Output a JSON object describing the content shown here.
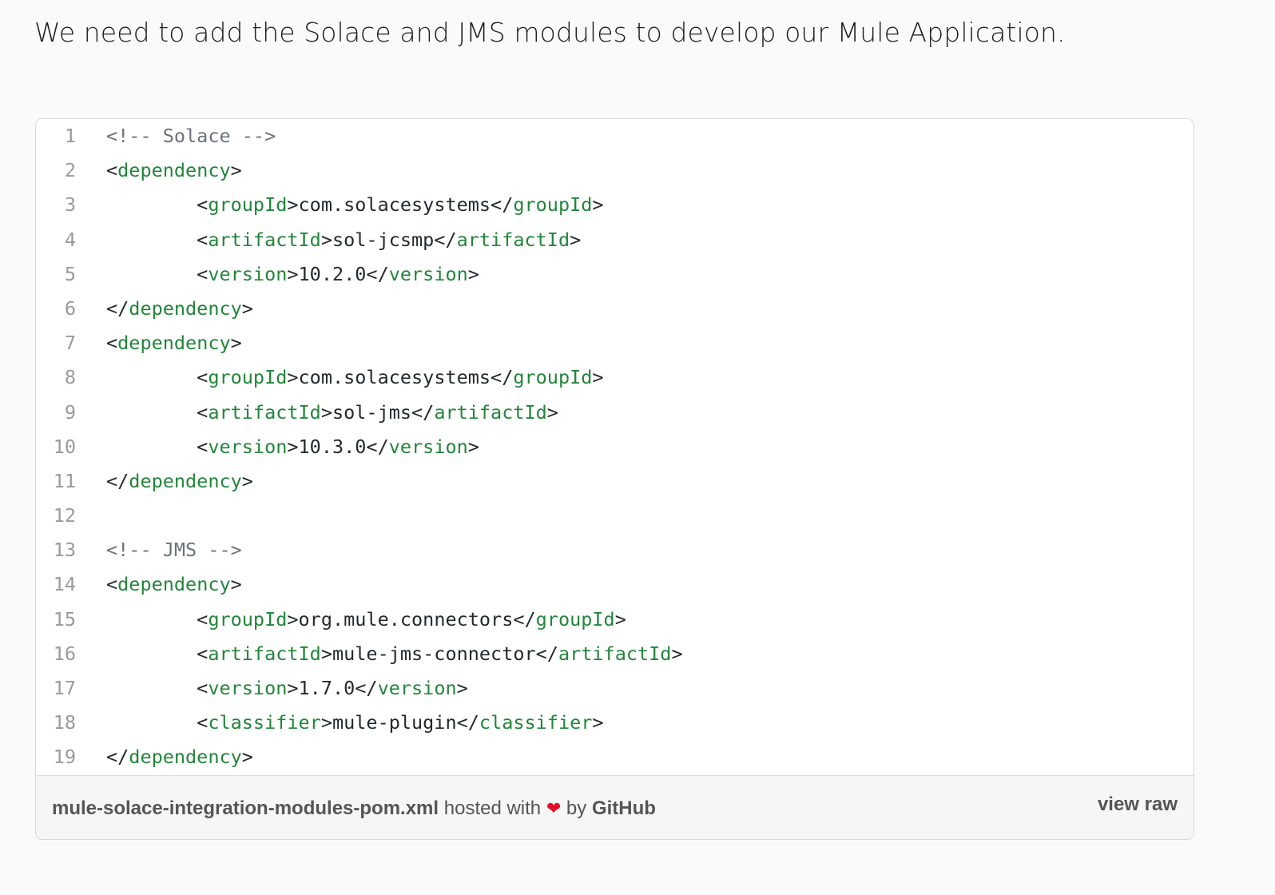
{
  "intro_text": "We need to add the Solace and JMS modules to develop our Mule Application.",
  "code_lines": [
    [
      {
        "t": "<!-- Solace -->",
        "k": "com"
      }
    ],
    [
      {
        "t": "<",
        "k": "punc"
      },
      {
        "t": "dependency",
        "k": "tag"
      },
      {
        "t": ">",
        "k": "punc"
      }
    ],
    [
      {
        "t": "        <",
        "k": "punc"
      },
      {
        "t": "groupId",
        "k": "tag"
      },
      {
        "t": ">com.solacesystems</",
        "k": "punc"
      },
      {
        "t": "groupId",
        "k": "tag"
      },
      {
        "t": ">",
        "k": "punc"
      }
    ],
    [
      {
        "t": "        <",
        "k": "punc"
      },
      {
        "t": "artifactId",
        "k": "tag"
      },
      {
        "t": ">sol-jcsmp</",
        "k": "punc"
      },
      {
        "t": "artifactId",
        "k": "tag"
      },
      {
        "t": ">",
        "k": "punc"
      }
    ],
    [
      {
        "t": "        <",
        "k": "punc"
      },
      {
        "t": "version",
        "k": "tag"
      },
      {
        "t": ">10.2.0</",
        "k": "punc"
      },
      {
        "t": "version",
        "k": "tag"
      },
      {
        "t": ">",
        "k": "punc"
      }
    ],
    [
      {
        "t": "</",
        "k": "punc"
      },
      {
        "t": "dependency",
        "k": "tag"
      },
      {
        "t": ">",
        "k": "punc"
      }
    ],
    [
      {
        "t": "<",
        "k": "punc"
      },
      {
        "t": "dependency",
        "k": "tag"
      },
      {
        "t": ">",
        "k": "punc"
      }
    ],
    [
      {
        "t": "        <",
        "k": "punc"
      },
      {
        "t": "groupId",
        "k": "tag"
      },
      {
        "t": ">com.solacesystems</",
        "k": "punc"
      },
      {
        "t": "groupId",
        "k": "tag"
      },
      {
        "t": ">",
        "k": "punc"
      }
    ],
    [
      {
        "t": "        <",
        "k": "punc"
      },
      {
        "t": "artifactId",
        "k": "tag"
      },
      {
        "t": ">sol-jms</",
        "k": "punc"
      },
      {
        "t": "artifactId",
        "k": "tag"
      },
      {
        "t": ">",
        "k": "punc"
      }
    ],
    [
      {
        "t": "        <",
        "k": "punc"
      },
      {
        "t": "version",
        "k": "tag"
      },
      {
        "t": ">10.3.0</",
        "k": "punc"
      },
      {
        "t": "version",
        "k": "tag"
      },
      {
        "t": ">",
        "k": "punc"
      }
    ],
    [
      {
        "t": "</",
        "k": "punc"
      },
      {
        "t": "dependency",
        "k": "tag"
      },
      {
        "t": ">",
        "k": "punc"
      }
    ],
    [],
    [
      {
        "t": "<!-- JMS -->",
        "k": "com"
      }
    ],
    [
      {
        "t": "<",
        "k": "punc"
      },
      {
        "t": "dependency",
        "k": "tag"
      },
      {
        "t": ">",
        "k": "punc"
      }
    ],
    [
      {
        "t": "        <",
        "k": "punc"
      },
      {
        "t": "groupId",
        "k": "tag"
      },
      {
        "t": ">org.mule.connectors</",
        "k": "punc"
      },
      {
        "t": "groupId",
        "k": "tag"
      },
      {
        "t": ">",
        "k": "punc"
      }
    ],
    [
      {
        "t": "        <",
        "k": "punc"
      },
      {
        "t": "artifactId",
        "k": "tag"
      },
      {
        "t": ">mule-jms-connector</",
        "k": "punc"
      },
      {
        "t": "artifactId",
        "k": "tag"
      },
      {
        "t": ">",
        "k": "punc"
      }
    ],
    [
      {
        "t": "        <",
        "k": "punc"
      },
      {
        "t": "version",
        "k": "tag"
      },
      {
        "t": ">1.7.0</",
        "k": "punc"
      },
      {
        "t": "version",
        "k": "tag"
      },
      {
        "t": ">",
        "k": "punc"
      }
    ],
    [
      {
        "t": "        <",
        "k": "punc"
      },
      {
        "t": "classifier",
        "k": "tag"
      },
      {
        "t": ">mule-plugin</",
        "k": "punc"
      },
      {
        "t": "classifier",
        "k": "tag"
      },
      {
        "t": ">",
        "k": "punc"
      }
    ],
    [
      {
        "t": "</",
        "k": "punc"
      },
      {
        "t": "dependency",
        "k": "tag"
      },
      {
        "t": ">",
        "k": "punc"
      }
    ]
  ],
  "footer": {
    "file_name": "mule-solace-integration-modules-pom.xml",
    "hosted_text": " hosted with ",
    "heart": "❤",
    "by_text": " by ",
    "brand": "GitHub",
    "view_raw": "view raw"
  },
  "colors": {
    "tag": "#22863a",
    "comment": "#6a737d",
    "text": "#24292e",
    "line_number": "#9a9a9a",
    "heart": "#e0102b"
  }
}
